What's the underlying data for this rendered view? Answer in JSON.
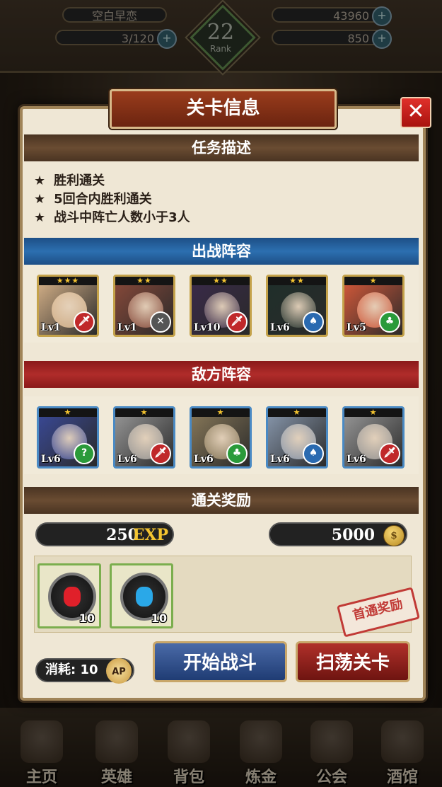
{
  "hud": {
    "player_name": "空白早恋",
    "ap": "3/120",
    "ap_icon_label": "AP",
    "gold": "43960",
    "gems": "850",
    "rank_num": "22",
    "rank_label": "Rank",
    "plus": "+"
  },
  "modal": {
    "title": "关卡信息",
    "close": "✕",
    "sections": {
      "mission": "任务描述",
      "team": "出战阵容",
      "enemy": "敌方阵容",
      "reward": "通关奖励"
    },
    "tasks": [
      "胜利通关",
      "5回合内胜利通关",
      "战斗中阵亡人数小于3人"
    ],
    "task_marker": "★",
    "team": [
      {
        "stars": "★★★",
        "level": "Lv1",
        "class_icon": "sword-icon",
        "class_glyph": "🗡",
        "class_color": "#c0282a",
        "face_color": "#d9b48a"
      },
      {
        "stars": "★★",
        "level": "Lv1",
        "class_icon": "bow-icon",
        "class_glyph": "✕",
        "class_color": "#555555",
        "face_color": "#8a4a3a"
      },
      {
        "stars": "★★",
        "level": "Lv10",
        "class_icon": "sword-icon",
        "class_glyph": "🗡",
        "class_color": "#c0282a",
        "face_color": "#3a2a4a"
      },
      {
        "stars": "★★",
        "level": "Lv6",
        "class_icon": "spear-icon",
        "class_glyph": "♠",
        "class_color": "#2a6ab0",
        "face_color": "#1f2f2a"
      },
      {
        "stars": "★",
        "level": "Lv5",
        "class_icon": "axe-icon",
        "class_glyph": "♣",
        "class_color": "#2a9a3a",
        "face_color": "#d85a3a"
      }
    ],
    "enemies": [
      {
        "stars": "★",
        "level": "Lv6",
        "class_icon": "staff-icon",
        "class_glyph": "?",
        "class_color": "#2a9a3a",
        "face_color": "#3a4a9a"
      },
      {
        "stars": "★",
        "level": "Lv6",
        "class_icon": "sword-icon",
        "class_glyph": "🗡",
        "class_color": "#c0282a",
        "face_color": "#9a9a9a"
      },
      {
        "stars": "★",
        "level": "Lv6",
        "class_icon": "axe-icon",
        "class_glyph": "♣",
        "class_color": "#2a9a3a",
        "face_color": "#8a7a5a"
      },
      {
        "stars": "★",
        "level": "Lv6",
        "class_icon": "spear-icon",
        "class_glyph": "♠",
        "class_color": "#2a6ab0",
        "face_color": "#8a9ab0"
      },
      {
        "stars": "★",
        "level": "Lv6",
        "class_icon": "sword-icon",
        "class_glyph": "🗡",
        "class_color": "#c0282a",
        "face_color": "#9a9a9a"
      }
    ],
    "rewards": {
      "exp_value": "250",
      "exp_unit": "EXP",
      "gold_value": "5000",
      "gold_icon": "coin-icon",
      "items": [
        {
          "icon": "red-gem-icon",
          "count": "10",
          "color": "#e0202a"
        },
        {
          "icon": "blue-gem-icon",
          "count": "10",
          "color": "#2aa8e8"
        }
      ],
      "first_clear_stamp": "首通奖励"
    },
    "cost_label": "消耗:",
    "cost_value": "10",
    "cost_unit": "AP",
    "start_button": "开始战斗",
    "sweep_button": "扫荡关卡"
  },
  "nav": [
    {
      "label": "主页",
      "icon": "castle-icon"
    },
    {
      "label": "英雄",
      "icon": "helmet-icon"
    },
    {
      "label": "背包",
      "icon": "backpack-icon"
    },
    {
      "label": "炼金",
      "icon": "flask-icon"
    },
    {
      "label": "公会",
      "icon": "shield-icon"
    },
    {
      "label": "酒馆",
      "icon": "tavern-icon"
    }
  ]
}
